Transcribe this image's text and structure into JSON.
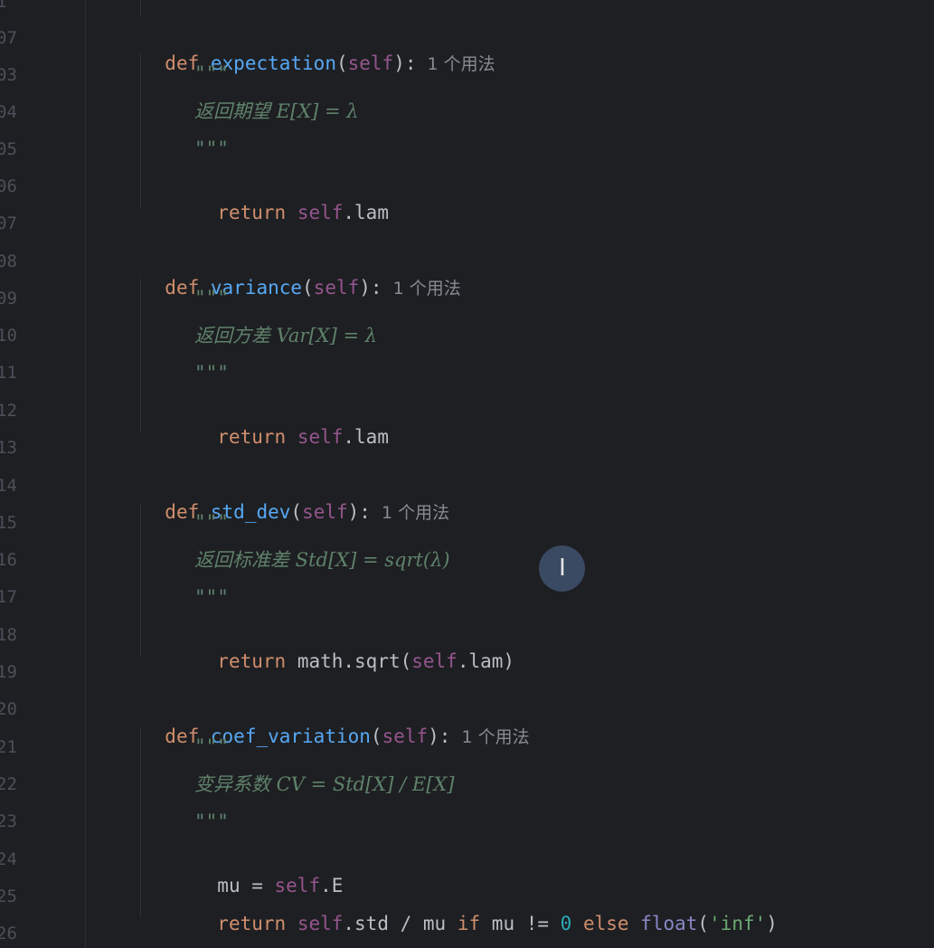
{
  "line_numbers": [
    "1",
    "07",
    "03",
    "04",
    "05",
    "06",
    "07",
    "08",
    "09",
    "10",
    "11",
    "12",
    "13",
    "14",
    "15",
    "16",
    "17",
    "18",
    "19",
    "20",
    "21",
    "22",
    "23",
    "24",
    "25",
    "26"
  ],
  "usage_hint": "1 个用法",
  "methods": [
    {
      "def": "def",
      "name": "expectation",
      "params": "self",
      "hint": "1 个用法",
      "quote": "\"\"\"",
      "doc": "返回期望 E[X] = λ",
      "body": [
        {
          "return": "return",
          "expr_self": "self",
          "expr_rest": ".lam"
        }
      ]
    },
    {
      "def": "def",
      "name": "variance",
      "params": "self",
      "hint": "1 个用法",
      "quote": "\"\"\"",
      "doc": "返回方差 Var[X] = λ",
      "body": [
        {
          "return": "return",
          "expr_self": "self",
          "expr_rest": ".lam"
        }
      ]
    },
    {
      "def": "def",
      "name": "std_dev",
      "params": "self",
      "hint": "1 个用法",
      "quote": "\"\"\"",
      "doc": "返回标准差 Std[X] = sqrt(λ)",
      "body": [
        {
          "return": "return",
          "pre": "math.sqrt(",
          "expr_self": "self",
          "expr_rest": ".lam)"
        }
      ]
    },
    {
      "def": "def",
      "name": "coef_variation",
      "params": "self",
      "hint": "1 个用法",
      "quote": "\"\"\"",
      "doc": "变异系数 CV = Std[X] / E[X]",
      "body": [
        {
          "assign": "mu = ",
          "expr_self": "self",
          "expr_rest": ".E"
        },
        {
          "return": "return",
          "expr_self": "self",
          "expr_rest": ".std / mu",
          "if": "if",
          "cond": "mu != ",
          "zero": "0",
          "else": "else",
          "float": "float",
          "open": "(",
          "str": "'inf'",
          "close": ")"
        }
      ]
    }
  ],
  "colors": {
    "background": "#1e1f22",
    "keyword": "#cf8e6d",
    "function": "#56a8f5",
    "self": "#94558d",
    "docstring": "#5f826b",
    "number": "#2aacb8",
    "string": "#6aab73"
  },
  "cursor_icon": "text-cursor-icon"
}
